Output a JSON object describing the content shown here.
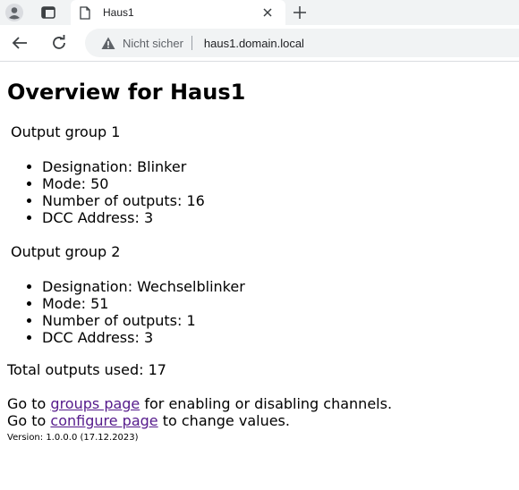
{
  "browser": {
    "tab_title": "Haus1",
    "security_label": "Nicht sicher",
    "url": "haus1.domain.local"
  },
  "page": {
    "heading": "Overview for Haus1",
    "groups": [
      {
        "title": "Output group 1",
        "items": [
          "Designation: Blinker",
          "Mode: 50",
          "Number of outputs: 16",
          "DCC Address: 3"
        ]
      },
      {
        "title": "Output group 2",
        "items": [
          "Designation: Wechselblinker",
          "Mode: 51",
          "Number of outputs: 1",
          "DCC Address: 3"
        ]
      }
    ],
    "total": "Total outputs used: 17",
    "goto_groups": {
      "prefix": "Go to ",
      "link": "groups page",
      "suffix": " for enabling or disabling channels."
    },
    "goto_configure": {
      "prefix": "Go to ",
      "link": "configure page",
      "suffix": " to change values."
    },
    "version": "Version: 1.0.0.0 (17.12.2023)"
  }
}
